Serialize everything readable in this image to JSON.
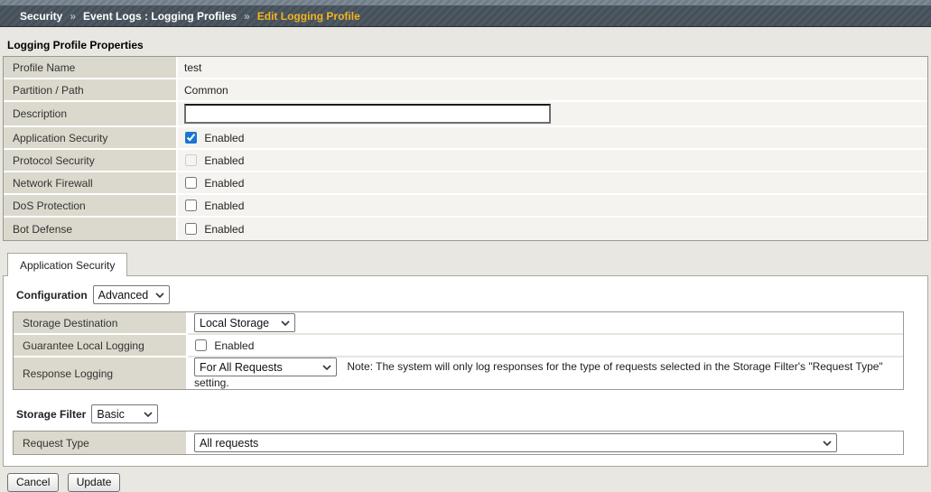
{
  "colors": {
    "breadcrumb_bg": "#4e5963",
    "breadcrumb_highlight": "#f0b51e",
    "checkbox_accent": "#1976d2",
    "label_cell_bg": "#dbd8cd",
    "value_cell_bg": "#f4f3ef",
    "page_bg": "#e8e7e1"
  },
  "breadcrumb": {
    "separator": "»",
    "items": [
      {
        "label": "Security"
      },
      {
        "label": "Event Logs : Logging Profiles"
      },
      {
        "label": "Edit Logging Profile"
      }
    ]
  },
  "properties": {
    "title": "Logging Profile Properties",
    "rows": {
      "profile_name": {
        "label": "Profile Name",
        "value": "test"
      },
      "partition": {
        "label": "Partition / Path",
        "value": "Common"
      },
      "description": {
        "label": "Description",
        "value": ""
      },
      "app_security": {
        "label": "Application Security",
        "value_label": "Enabled",
        "checked": true
      },
      "protocol_security": {
        "label": "Protocol Security",
        "value_label": "Enabled",
        "checked": false,
        "disabled": true
      },
      "network_firewall": {
        "label": "Network Firewall",
        "value_label": "Enabled",
        "checked": false
      },
      "dos_protection": {
        "label": "DoS Protection",
        "value_label": "Enabled",
        "checked": false
      },
      "bot_defense": {
        "label": "Bot Defense",
        "value_label": "Enabled",
        "checked": false
      }
    }
  },
  "tab": {
    "label": "Application Security"
  },
  "configuration": {
    "label": "Configuration",
    "selected": "Advanced"
  },
  "config_table": {
    "storage_destination": {
      "label": "Storage Destination",
      "selected": "Local Storage"
    },
    "guarantee_local_logging": {
      "label": "Guarantee Local Logging",
      "value_label": "Enabled",
      "checked": false
    },
    "response_logging": {
      "label": "Response Logging",
      "selected": "For All Requests",
      "note": "Note: The system will only log responses for the type of requests selected in the Storage Filter's \"Request Type\" setting."
    }
  },
  "storage_filter": {
    "label": "Storage Filter",
    "selected": "Basic"
  },
  "filter_table": {
    "request_type": {
      "label": "Request Type",
      "selected": "All requests"
    }
  },
  "actions": {
    "cancel": "Cancel",
    "update": "Update"
  }
}
